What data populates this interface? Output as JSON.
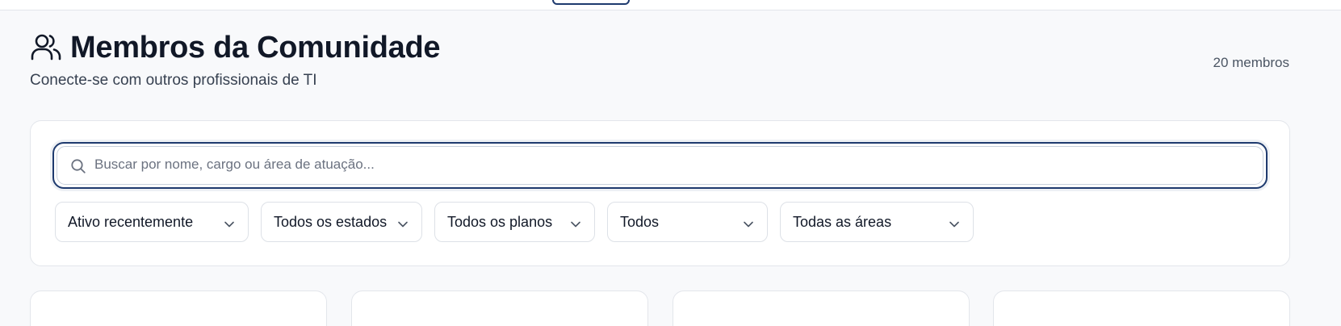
{
  "header": {
    "title": "Membros da Comunidade",
    "subtitle": "Conecte-se com outros profissionais de TI",
    "member_count": "20 membros",
    "icon": "users-icon"
  },
  "search": {
    "placeholder": "Buscar por nome, cargo ou área de atuação...",
    "value": ""
  },
  "filters": [
    {
      "label": "Ativo recentemente"
    },
    {
      "label": "Todos os estados"
    },
    {
      "label": "Todos os planos"
    },
    {
      "label": "Todos"
    },
    {
      "label": "Todas as áreas"
    }
  ],
  "colors": {
    "accent": "#1e3a6e",
    "background": "#f8f9fb",
    "text": "#111827"
  }
}
